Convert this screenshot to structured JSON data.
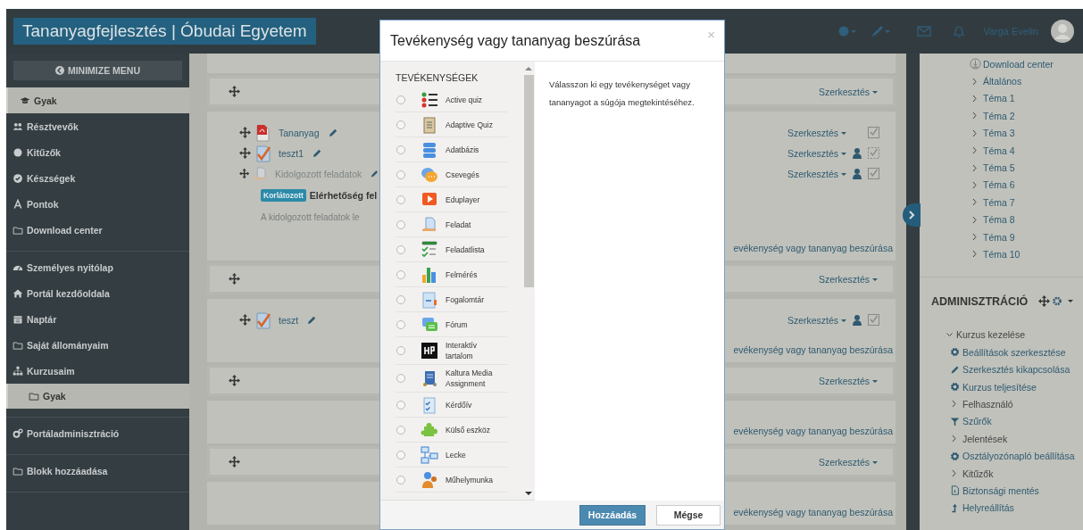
{
  "header": {
    "brand": "Tananyagfejlesztés | Óbudai Egyetem",
    "user_name": "Varga Evelin"
  },
  "sidebar": {
    "minimize_button": "MINIMIZE MENU",
    "groups": [
      {
        "items": [
          {
            "label": "Gyak",
            "kind": "cap",
            "selected": true
          },
          {
            "label": "Résztvevők",
            "kind": "users",
            "selected": false
          },
          {
            "label": "Kitűzők",
            "kind": "dot",
            "selected": false
          },
          {
            "label": "Készségek",
            "kind": "check",
            "selected": false
          },
          {
            "label": "Pontok",
            "kind": "letter",
            "selected": false
          },
          {
            "label": "Download center",
            "kind": "folder",
            "selected": false
          }
        ]
      },
      {
        "items": [
          {
            "label": "Személyes nyitólap",
            "kind": "gauge",
            "selected": false
          },
          {
            "label": "Portál kezdőoldala",
            "kind": "home",
            "selected": false
          },
          {
            "label": "Naptár",
            "kind": "calendar",
            "selected": false
          },
          {
            "label": "Saját állományaim",
            "kind": "folder",
            "selected": false
          },
          {
            "label": "Kurzusaim",
            "kind": "sitemap",
            "selected": false,
            "children": [
              {
                "label": "Gyak",
                "kind": "folder",
                "selected": true
              }
            ]
          }
        ]
      },
      {
        "items": [
          {
            "label": "Portáladminisztráció",
            "kind": "cogs",
            "selected": false
          }
        ]
      },
      {
        "items": [
          {
            "label": "Blokk hozzáadása",
            "kind": "folder",
            "selected": false
          }
        ]
      }
    ]
  },
  "course": {
    "sections": [
      {
        "edit": "Szerkesztés",
        "activities": [
          {
            "name": "Tananyag",
            "kind": "pdf",
            "hidden": false,
            "edit": "Szerkesztés",
            "group_icon": false,
            "auto_completion": false
          },
          {
            "name": "teszt1",
            "kind": "quiz",
            "hidden": false,
            "edit": "Szerkesztés",
            "group_icon": true,
            "auto_completion": true
          },
          {
            "name": "Kidolgozott feladatok",
            "kind": "assign",
            "hidden": true,
            "edit": "Szerkesztés",
            "group_icon": true,
            "auto_completion": false,
            "restriction": {
              "badge": "Korlátozott",
              "text": "Elérhetőség fel"
            },
            "description": "A kidolgozott feladatok le"
          }
        ],
        "add_link": "evékenység vagy tananyag beszúrása"
      },
      {
        "edit": "Szerkesztés",
        "activities": [
          {
            "name": "teszt",
            "kind": "quiz",
            "hidden": false,
            "edit": "Szerkesztés",
            "group_icon": true,
            "auto_completion": false
          }
        ],
        "add_link": "evékenység vagy tananyag beszúrása"
      },
      {
        "edit": "Szerkesztés",
        "add_link": "evékenység vagy tananyag beszúrása"
      },
      {
        "edit": "Szerkesztés",
        "add_link": "evékenység vagy tananyag beszúrása"
      }
    ]
  },
  "dialog": {
    "title": "Tevékenység vagy tananyag beszúrása",
    "close": "×",
    "list_heading": "TEVÉKENYSÉGEK",
    "options": [
      {
        "label": "Active quiz",
        "kind": "list",
        "selected": false
      },
      {
        "label": "Adaptive Quiz",
        "kind": "clipboard",
        "selected": false
      },
      {
        "label": "Adatbázis",
        "kind": "database",
        "selected": false
      },
      {
        "label": "Csevegés",
        "kind": "chat",
        "selected": false
      },
      {
        "label": "Eduplayer",
        "kind": "play",
        "selected": false
      },
      {
        "label": "Feladat",
        "kind": "handdoc",
        "selected": false
      },
      {
        "label": "Feladatlista",
        "kind": "checklist",
        "selected": false
      },
      {
        "label": "Felmérés",
        "kind": "bars",
        "selected": false
      },
      {
        "label": "Fogalomtár",
        "kind": "glossary",
        "selected": false
      },
      {
        "label": "Fórum",
        "kind": "forum",
        "selected": false
      },
      {
        "label": "Interaktív tartalom",
        "kind": "blacksquare",
        "selected": false
      },
      {
        "label": "Kaltura Media Assignment",
        "kind": "book",
        "selected": false
      },
      {
        "label": "Kérdőív",
        "kind": "survey",
        "selected": false
      },
      {
        "label": "Külső eszköz",
        "kind": "puzzle",
        "selected": false
      },
      {
        "label": "Lecke",
        "kind": "flow",
        "selected": false
      },
      {
        "label": "Műhelymunka",
        "kind": "people",
        "selected": false
      }
    ],
    "help_text": "Válasszon ki egy tevékenységet vagy tananyagot a súgója megtekintéséhez.",
    "buttons": [
      {
        "label": "Hozzáadás",
        "kind": "primary"
      },
      {
        "label": "Mégse",
        "kind": "secondary"
      }
    ]
  },
  "blocks": {
    "navigation": [
      {
        "label": "Download center",
        "kind": "download"
      },
      {
        "label": "Általános",
        "kind": "branch",
        "expanded": false
      },
      {
        "label": "Téma 1",
        "kind": "branch",
        "expanded": false
      },
      {
        "label": "Téma 2",
        "kind": "branch",
        "expanded": false
      },
      {
        "label": "Téma 3",
        "kind": "branch",
        "expanded": false
      },
      {
        "label": "Téma 4",
        "kind": "branch",
        "expanded": false
      },
      {
        "label": "Téma 5",
        "kind": "branch",
        "expanded": false
      },
      {
        "label": "Téma 6",
        "kind": "branch",
        "expanded": false
      },
      {
        "label": "Téma 7",
        "kind": "branch",
        "expanded": false
      },
      {
        "label": "Téma 8",
        "kind": "branch",
        "expanded": false
      },
      {
        "label": "Téma 9",
        "kind": "branch",
        "expanded": false
      },
      {
        "label": "Téma 10",
        "kind": "branch",
        "expanded": false
      }
    ],
    "admin": {
      "title": "ADMINISZTRÁCIÓ",
      "tree": [
        {
          "label": "Kurzus kezelése",
          "kind": "branch",
          "expanded": true,
          "children": [
            {
              "label": "Beállítások szerkesztése",
              "kind": "gear"
            },
            {
              "label": "Szerkesztés kikapcsolása",
              "kind": "pencil"
            },
            {
              "label": "Kurzus teljesítése",
              "kind": "gear"
            },
            {
              "label": "Felhasználó",
              "kind": "branch",
              "expanded": false
            },
            {
              "label": "Szűrők",
              "kind": "filter"
            },
            {
              "label": "Jelentések",
              "kind": "branch",
              "expanded": false
            },
            {
              "label": "Osztályozónapló beállítása",
              "kind": "gear"
            },
            {
              "label": "Kitűzők",
              "kind": "branch",
              "expanded": false
            },
            {
              "label": "Biztonsági mentés",
              "kind": "file"
            },
            {
              "label": "Helyreállítás",
              "kind": "upload"
            }
          ]
        }
      ]
    }
  }
}
